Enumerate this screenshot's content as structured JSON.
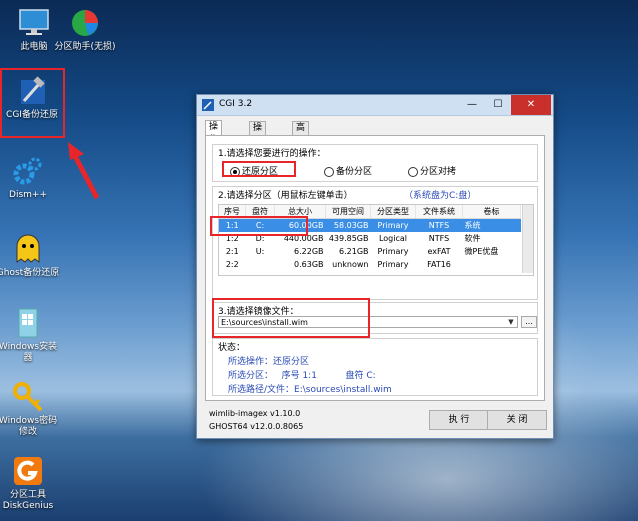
{
  "desktop": {
    "icons": [
      {
        "label": "此电脑",
        "icon": "computer-icon"
      },
      {
        "label": "分区助手(无损)",
        "icon": "partition-assistant-icon"
      },
      {
        "label": "CGI备份还原",
        "icon": "cgi-hammer-icon"
      },
      {
        "label": "Dism++",
        "icon": "gears-icon"
      },
      {
        "label": "Ghost备份还原",
        "icon": "ghost-icon"
      },
      {
        "label": "Windows安装器",
        "icon": "windows-installer-icon"
      },
      {
        "label": "Windows密码修改",
        "icon": "keys-icon"
      },
      {
        "label": "分区工具DiskGenius",
        "icon": "diskgenius-icon"
      }
    ]
  },
  "window": {
    "title": "CGI 3.2",
    "buttons": {
      "minimize": "—",
      "maximize": "☐",
      "close": "✕"
    },
    "tabs": [
      "操作分区",
      "操作硬盘",
      "高 级"
    ],
    "operation": {
      "title": "1.请选择您要进行的操作：",
      "options": [
        "还原分区",
        "备份分区",
        "分区对拷"
      ],
      "selected": "还原分区"
    },
    "partition": {
      "title": "2.请选择分区（用鼠标左键单击）",
      "system_note": "（系统盘为C:盘）",
      "columns": [
        "序号",
        "盘符",
        "总大小",
        "可用空间",
        "分区类型",
        "文件系统",
        "卷标"
      ],
      "rows": [
        [
          "1:1",
          "C:",
          "60.00GB",
          "58.03GB",
          "Primary",
          "NTFS",
          "系统"
        ],
        [
          "1:2",
          "D:",
          "440.00GB",
          "439.85GB",
          "Logical",
          "NTFS",
          "软件"
        ],
        [
          "2:1",
          "U:",
          "6.22GB",
          "6.21GB",
          "Primary",
          "exFAT",
          "微PE优盘"
        ],
        [
          "2:2",
          "",
          "0.63GB",
          "unknown",
          "Primary",
          "FAT16",
          ""
        ]
      ],
      "selected_row": 0
    },
    "image": {
      "title": "3.请选择镜像文件：",
      "path": "E:\\sources\\install.wim",
      "browse_label": "..."
    },
    "status": {
      "title": "状态：",
      "operation_label": "所选操作：还原分区",
      "partition_label": "所选分区：   序号 1:1          盘符 C:",
      "path_label": "所选路径/文件：E:\\sources\\install.wim"
    },
    "footer": {
      "wimlib": "wimlib-imagex v1.10.0",
      "ghost": "GHOST64 v12.0.0.8065"
    },
    "actions": {
      "execute": "执 行",
      "close": "关 闭"
    }
  },
  "colors": {
    "highlight_red": "#e8262a",
    "selection_blue": "#3a8ee6",
    "status_blue": "#2a4bb5"
  }
}
